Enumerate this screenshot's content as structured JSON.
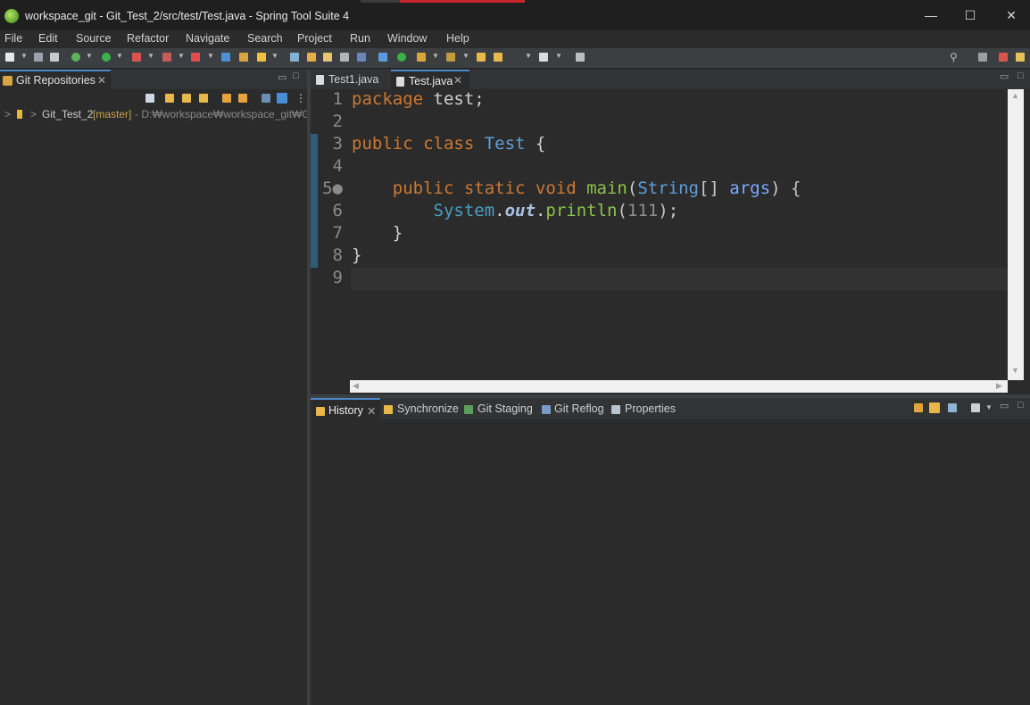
{
  "window": {
    "title": "workspace_git - Git_Test_2/src/test/Test.java - Spring Tool Suite 4",
    "minimize": "—",
    "maximize": "☐",
    "close": "✕"
  },
  "menu": [
    "File",
    "Edit",
    "Source",
    "Refactor",
    "Navigate",
    "Search",
    "Project",
    "Run",
    "Window",
    "Help"
  ],
  "left_view": {
    "tab_label": "Git Repositories",
    "close": "✕",
    "repo": {
      "expander": ">",
      "decorator": ">",
      "name": "Git_Test_2",
      "branch": "[master]",
      "path": "- D:₩workspace₩workspace_git₩Gi"
    }
  },
  "editor": {
    "tabs": [
      {
        "label": "Test1.java",
        "active": false
      },
      {
        "label": "Test.java",
        "active": true
      }
    ],
    "close": "✕",
    "lines": [
      {
        "num": "1",
        "tokens": [
          [
            "kw",
            "package"
          ],
          [
            "id",
            " test;"
          ]
        ]
      },
      {
        "num": "2",
        "tokens": []
      },
      {
        "num": "3",
        "tokens": [
          [
            "kw",
            "public class "
          ],
          [
            "ty",
            "Test"
          ],
          [
            "id",
            " {"
          ]
        ]
      },
      {
        "num": "4",
        "tokens": []
      },
      {
        "num": "5●",
        "tokens": [
          [
            "id",
            "    "
          ],
          [
            "kw",
            "public static void "
          ],
          [
            "fn",
            "main"
          ],
          [
            "par",
            "("
          ],
          [
            "ty",
            "String"
          ],
          [
            "par",
            "[] "
          ],
          [
            "arg",
            "args"
          ],
          [
            "par",
            ") {"
          ]
        ]
      },
      {
        "num": "6",
        "tokens": [
          [
            "id",
            "        "
          ],
          [
            "sys",
            "System"
          ],
          [
            "id",
            "."
          ],
          [
            "stat",
            "out"
          ],
          [
            "id",
            "."
          ],
          [
            "fn",
            "println"
          ],
          [
            "par",
            "("
          ],
          [
            "num",
            "111"
          ],
          [
            "par",
            ");"
          ]
        ]
      },
      {
        "num": "7",
        "tokens": [
          [
            "id",
            "    }"
          ]
        ]
      },
      {
        "num": "8",
        "tokens": [
          [
            "id",
            "}"
          ]
        ]
      },
      {
        "num": "9",
        "tokens": []
      }
    ],
    "scroll_up": "▲",
    "scroll_down": "▼",
    "scroll_left": "◀",
    "scroll_right": "▶"
  },
  "bottom_view": {
    "tabs": [
      "History",
      "Synchronize",
      "Git Staging",
      "Git Reflog",
      "Properties"
    ],
    "close": "✕"
  },
  "icons": {
    "app": "spring-leaf-icon",
    "view_min": "▭",
    "view_max": "□"
  }
}
